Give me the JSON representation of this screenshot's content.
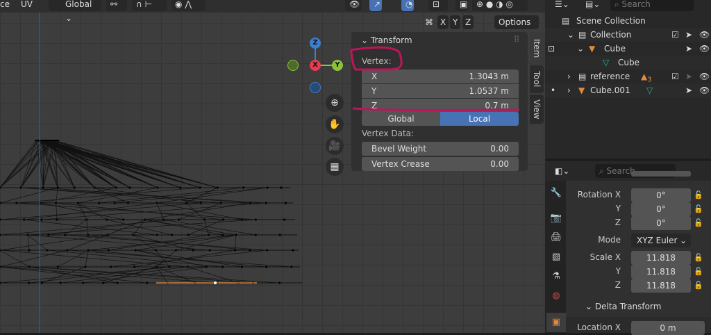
{
  "header": {
    "mode_partial": "ce",
    "uv": "UV",
    "orientation": "Global",
    "options": "Options",
    "axes": [
      "X",
      "Y",
      "Z"
    ]
  },
  "gizmo": {
    "x": "X",
    "y": "Y",
    "z": "Z"
  },
  "npanel": {
    "title": "Transform",
    "vertex_label": "Vertex:",
    "fields": [
      {
        "label": "X",
        "value": "1.3043 m"
      },
      {
        "label": "Y",
        "value": "1.0537 m"
      },
      {
        "label": "Z",
        "value": "0.7 m"
      }
    ],
    "space": {
      "global": "Global",
      "local": "Local",
      "active": "Local"
    },
    "vertex_data_label": "Vertex Data:",
    "data_fields": [
      {
        "label": "Bevel Weight",
        "value": "0.00"
      },
      {
        "label": "Vertex Crease",
        "value": "0.00"
      }
    ]
  },
  "side_tabs": [
    "Item",
    "Tool",
    "View"
  ],
  "outliner": {
    "search_placeholder": "Search",
    "items": [
      "Scene Collection",
      "Collection",
      "Cube",
      "Cube",
      "reference",
      "Cube.001"
    ],
    "reference_count": "3"
  },
  "properties": {
    "search_placeholder": "Search",
    "rotation": [
      {
        "label": "Rotation X",
        "value": "0°"
      },
      {
        "label": "Y",
        "value": "0°"
      },
      {
        "label": "Z",
        "value": "0°"
      }
    ],
    "mode_label": "Mode",
    "mode_value": "XYZ Euler",
    "scale": [
      {
        "label": "Scale X",
        "value": "11.818"
      },
      {
        "label": "Y",
        "value": "11.818"
      },
      {
        "label": "Z",
        "value": "11.818"
      }
    ],
    "delta_title": "Delta Transform",
    "location_label": "Location X",
    "location_value": "0 m"
  },
  "colors": {
    "accent": "#4772b3",
    "annotation": "#c0145a",
    "x_axis": "#e83a50",
    "y_axis": "#8ac33a",
    "z_axis": "#3b7fd0"
  }
}
